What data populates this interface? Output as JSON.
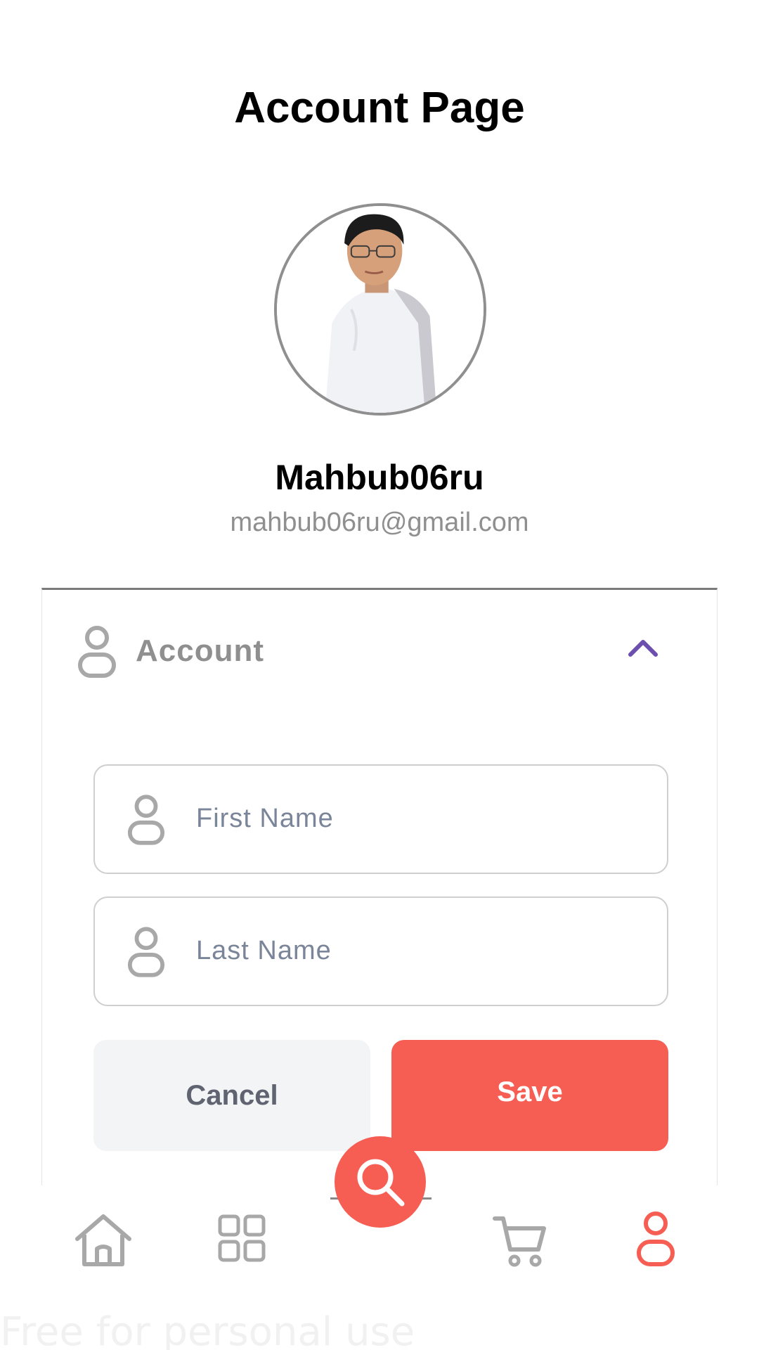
{
  "page": {
    "title": "Account Page"
  },
  "profile": {
    "username": "Mahbub06ru",
    "email": "mahbub06ru@gmail.com",
    "avatar_icon": "profile-photo"
  },
  "account_section": {
    "title": "Account",
    "icon": "person-icon",
    "expanded": true,
    "chevron_icon": "chevron-up-icon",
    "chevron_color": "#6d4fb0",
    "fields": [
      {
        "placeholder": "First Name",
        "value": "",
        "icon": "person-icon"
      },
      {
        "placeholder": "Last Name",
        "value": "",
        "icon": "person-icon"
      }
    ],
    "cancel_label": "Cancel",
    "save_label": "Save"
  },
  "nav": {
    "items": [
      {
        "icon": "home-icon",
        "active": false
      },
      {
        "icon": "grid-icon",
        "active": false
      },
      {
        "icon": "search-icon",
        "active": false
      },
      {
        "icon": "cart-icon",
        "active": false
      },
      {
        "icon": "profile-icon",
        "active": true
      }
    ],
    "active_color": "#f65e54",
    "inactive_color": "#a8a8a8"
  },
  "watermark": "Free for personal use",
  "colors": {
    "accent": "#f65e54",
    "muted_text": "#8f8f8f",
    "placeholder": "#7b859a"
  }
}
